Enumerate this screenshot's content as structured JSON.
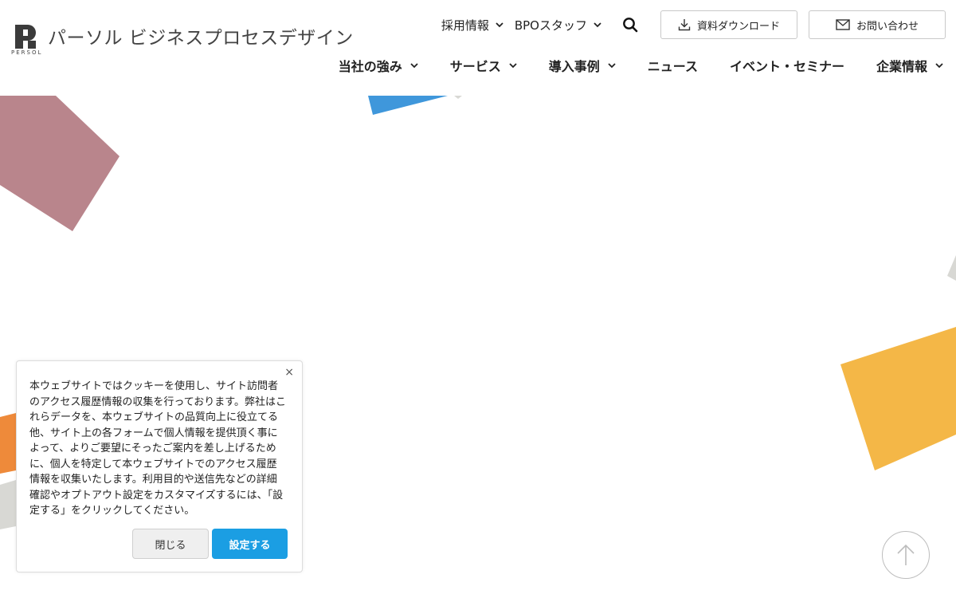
{
  "brand": {
    "name": "パーソル ビジネスプロセスデザイン",
    "sub": "PERSOL"
  },
  "utility": {
    "recruit_label": "採用情報",
    "bpo_label": "BPOスタッフ",
    "download_label": "資料ダウンロード",
    "contact_label": "お問い合わせ"
  },
  "nav": {
    "strengths": "当社の強み",
    "services": "サービス",
    "cases": "導入事例",
    "news": "ニュース",
    "events": "イベント・セミナー",
    "company": "企業情報"
  },
  "cookie": {
    "text": "本ウェブサイトではクッキーを使用し、サイト訪問者のアクセス履歴情報の収集を行っております。弊社はこれらデータを、本ウェブサイトの品質向上に役立てる他、サイト上の各フォームで個人情報を提供頂く事によって、よりご要望にそったご案内を差し上げるために、個人を特定して本ウェブサイトでのアクセス履歴情報を収集いたします。利用目的や送信先などの詳細確認やオプトアウト設定をカスタマイズするには、「設定する」をクリックしてください。",
    "close_label": "閉じる",
    "settings_label": "設定する",
    "close_glyph": "×"
  },
  "icons": {
    "search": "search-icon",
    "download": "download-icon",
    "mail": "mail-icon",
    "chevron": "chevron-down-icon",
    "to_top": "arrow-up-icon"
  },
  "colors": {
    "accent_blue": "#1b9ee3",
    "shape_rose": "#b9858c",
    "shape_blue": "#3f97db",
    "shape_yellow": "#f4b747",
    "shape_orange": "#ee8a3a",
    "shape_gray": "#d8d8d4"
  }
}
